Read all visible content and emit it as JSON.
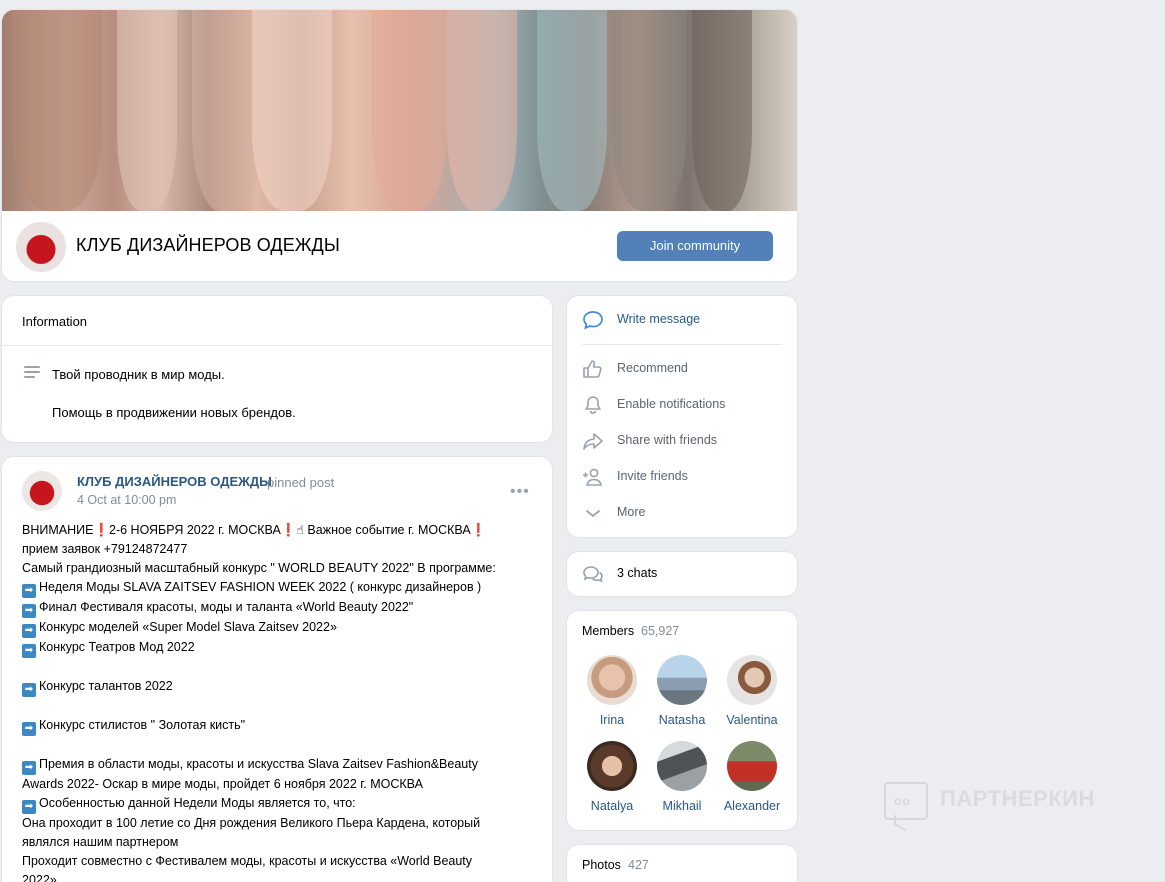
{
  "header": {
    "group_name": "КЛУБ ДИЗАЙНЕРОВ ОДЕЖДЫ",
    "join_label": "Join community"
  },
  "info": {
    "heading": "Information",
    "line1": "Твой проводник в мир моды.",
    "line2": "Помощь в продвижении новых брендов."
  },
  "post": {
    "author": "КЛУБ ДИЗАЙНЕРОВ ОДЕЖДЫ",
    "pinned": "pinned post",
    "date": "4 Oct at 10:00 pm",
    "menu": "•••",
    "lines": [
      "ВНИМАНИЕ❗2-6 НОЯБРЯ 2022 г. МОСКВА❗☝ Важное событие г. МОСКВА❗",
      "прием заявок +79124872477",
      "Самый грандиозный масштабный конкурс \" WORLD BEAUTY 2022\" В программе:",
      "Неделя Моды SLAVA ZAITSEV FASHION WEEK 2022 ( конкурс дизайнеров )",
      "Финал Фестиваля красоты, моды и таланта «World Beauty 2022\"",
      "Конкурс моделей «Super Model Slava Zaitsev 2022»",
      "Конкурс Театров Мод 2022",
      "",
      "Конкурс талантов 2022",
      "",
      "Конкурс стилистов \" Золотая кисть\"",
      "",
      "Премия в области моды, красоты и искусства Slava Zaitsev Fashion&Beauty",
      "Awards 2022- Оскар в мире моды, пройдет 6 ноября 2022 г. МОСКВА",
      "Особенностью данной Недели Моды является то, что:",
      "Она проходит в 100 летие со Дня рождения Великого Пьера Кардена, который",
      "являлся нашим партнером",
      "Проходит совместно с Фестивалем моды, красоты и искусства «World Beauty",
      "2022»"
    ],
    "arrow_glyph": "➡"
  },
  "actions": {
    "write": "Write message",
    "recommend": "Recommend",
    "notify": "Enable notifications",
    "share": "Share with friends",
    "invite": "Invite friends",
    "more": "More"
  },
  "chats": {
    "label": "3 chats"
  },
  "members": {
    "title": "Members",
    "count": "65,927",
    "list": [
      {
        "name": "Irina"
      },
      {
        "name": "Natasha"
      },
      {
        "name": "Valentina"
      },
      {
        "name": "Natalya"
      },
      {
        "name": "Mikhail"
      },
      {
        "name": "Alexander"
      }
    ]
  },
  "photos": {
    "title": "Photos",
    "count": "427"
  },
  "watermark": {
    "text": "ПАРТНЕРКИН",
    "eyes": "oo"
  },
  "colors": {
    "accent": "#5181b8",
    "link": "#2a5885",
    "muted": "#818c99",
    "bg": "#ebedf0"
  }
}
